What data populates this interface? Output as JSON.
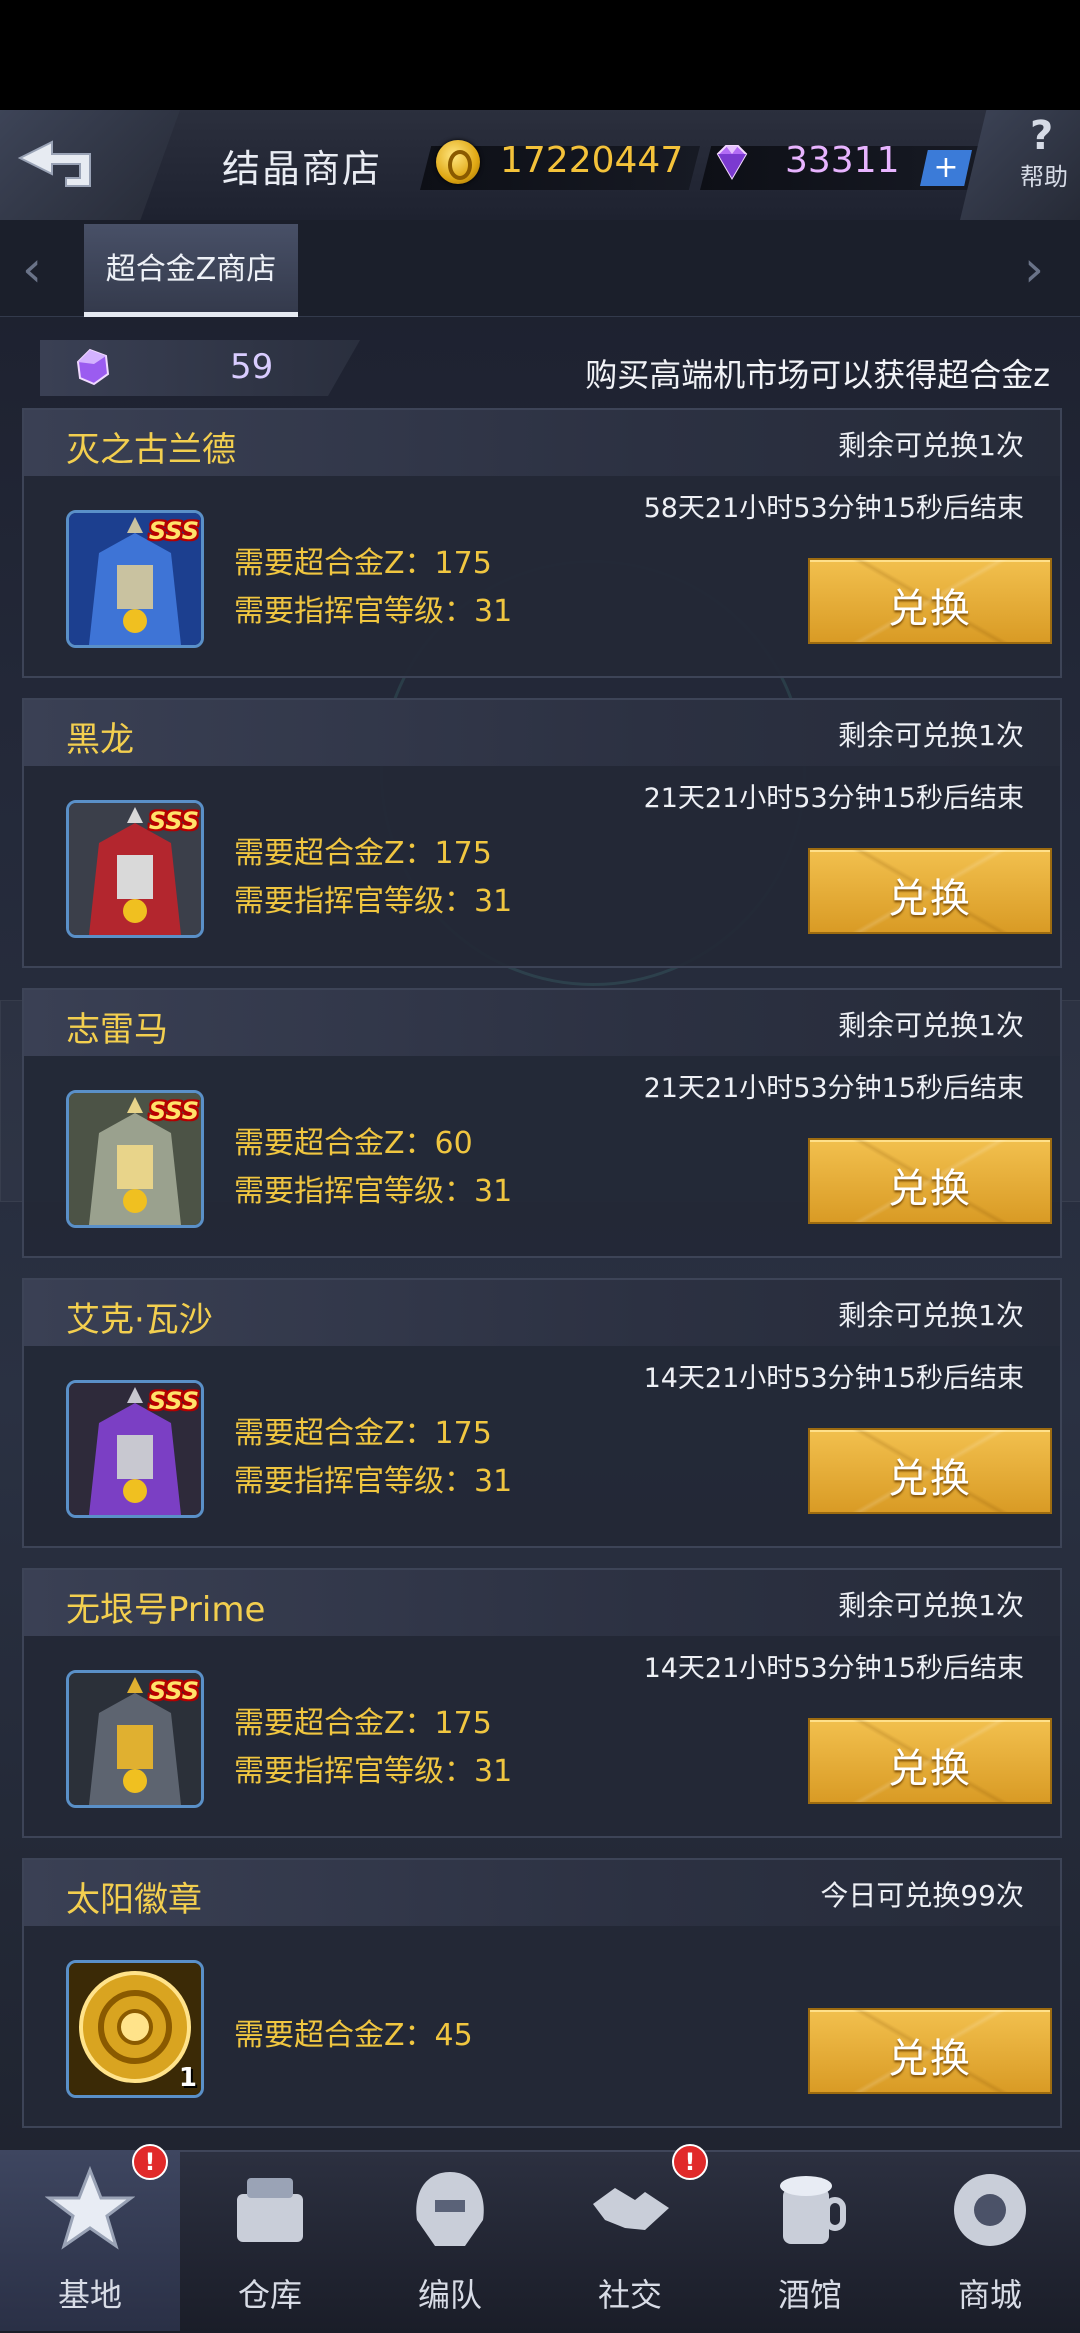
{
  "header": {
    "title": "结晶商店",
    "coins": "17220447",
    "gems": "33311",
    "plus": "+",
    "help_label": "帮助",
    "help_symbol": "?"
  },
  "tabs": [
    {
      "label": "超合金Z商店",
      "active": true
    }
  ],
  "info": {
    "currency_count": "59",
    "hint": "购买高端机市场可以获得超合金z"
  },
  "items": [
    {
      "name": "灭之古兰德",
      "remain": "剩余可兑换1次",
      "timer": "58天21小时53分钟15秒后结束",
      "req1": "需要超合金Z：175",
      "req2": "需要指挥官等级：31",
      "button": "兑换",
      "rank": "SSS",
      "palette": "blue"
    },
    {
      "name": "黑龙",
      "remain": "剩余可兑换1次",
      "timer": "21天21小时53分钟15秒后结束",
      "req1": "需要超合金Z：175",
      "req2": "需要指挥官等级：31",
      "button": "兑换",
      "rank": "SSS",
      "palette": "red"
    },
    {
      "name": "志雷马",
      "remain": "剩余可兑换1次",
      "timer": "21天21小时53分钟15秒后结束",
      "req1": "需要超合金Z：60",
      "req2": "需要指挥官等级：31",
      "button": "兑换",
      "rank": "SSS",
      "palette": "gray"
    },
    {
      "name": "艾克·瓦沙",
      "remain": "剩余可兑换1次",
      "timer": "14天21小时53分钟15秒后结束",
      "req1": "需要超合金Z：175",
      "req2": "需要指挥官等级：31",
      "button": "兑换",
      "rank": "SSS",
      "palette": "purple"
    },
    {
      "name": "无垠号Prime",
      "remain": "剩余可兑换1次",
      "timer": "14天21小时53分钟15秒后结束",
      "req1": "需要超合金Z：175",
      "req2": "需要指挥官等级：31",
      "button": "兑换",
      "rank": "SSS",
      "palette": "dark"
    },
    {
      "name": "太阳徽章",
      "remain": "今日可兑换99次",
      "timer": "",
      "req1": "需要超合金Z：45",
      "req2": "",
      "button": "兑换",
      "rank": "",
      "qty": "1",
      "palette": "gold"
    }
  ],
  "nav": [
    {
      "label": "基地",
      "icon": "base-icon",
      "active": true,
      "badge": "!"
    },
    {
      "label": "仓库",
      "icon": "warehouse-icon",
      "active": false,
      "badge": ""
    },
    {
      "label": "编队",
      "icon": "formation-icon",
      "active": false,
      "badge": ""
    },
    {
      "label": "社交",
      "icon": "social-icon",
      "active": false,
      "badge": "!"
    },
    {
      "label": "酒馆",
      "icon": "tavern-icon",
      "active": false,
      "badge": ""
    },
    {
      "label": "商城",
      "icon": "mall-icon",
      "active": false,
      "badge": ""
    }
  ],
  "colors": {
    "accent_gold": "#f0c640",
    "button_gold": "#e3a935",
    "coin_text": "#f4c23a",
    "gem_text": "#e8b4ff",
    "badge_red": "#e12a2a"
  }
}
